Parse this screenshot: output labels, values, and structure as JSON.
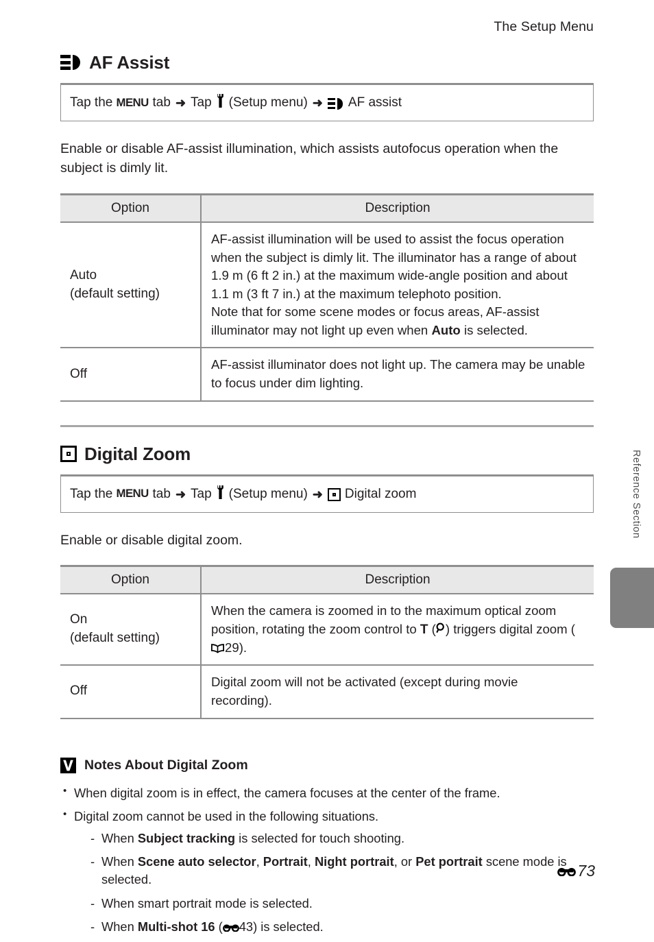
{
  "page": {
    "running_head": "The Setup Menu",
    "side_tab_label": "Reference Section",
    "footer_page": "73",
    "accent_gray": "#808080",
    "rule_gray": "#8e8e8e",
    "header_fill": "#e8e8e8"
  },
  "sections": [
    {
      "id": "af-assist",
      "icon": "af-assist-icon",
      "title": "AF Assist",
      "path": {
        "prefix": "Tap the",
        "menu_word": "MENU",
        "tab_word": "tab",
        "arrow": "➜",
        "tap_word": "Tap",
        "setup_icon": "wrench-icon",
        "setup_label": "(Setup menu)",
        "target_icon": "af-assist-icon",
        "target_label": "AF assist"
      },
      "intro": "Enable or disable AF-assist illumination, which assists autofocus operation when the subject is dimly lit.",
      "table": {
        "headers": [
          "Option",
          "Description"
        ],
        "rows": [
          {
            "option": "Auto",
            "option_note": "(default setting)",
            "description_lines": [
              "AF-assist illumination will be used to assist the focus operation",
              "when the subject is dimly lit. The illuminator has a range of about",
              "1.9 m (6 ft 2 in.) at the maximum wide-angle position and about",
              "1.1 m (3 ft 7 in.) at the maximum telephoto position.",
              "Note that for some scene modes or focus areas, AF-assist"
            ],
            "description_last_pre": "illuminator may not light up even when ",
            "description_last_bold": "Auto",
            "description_last_post": " is selected."
          },
          {
            "option": "Off",
            "option_note": "",
            "description_lines": [
              "AF-assist illuminator does not light up. The camera may be unable",
              "to focus under dim lighting."
            ]
          }
        ]
      }
    },
    {
      "id": "digital-zoom",
      "icon": "digital-zoom-icon",
      "title": "Digital Zoom",
      "path": {
        "prefix": "Tap the",
        "menu_word": "MENU",
        "tab_word": "tab",
        "arrow": "➜",
        "tap_word": "Tap",
        "setup_icon": "wrench-icon",
        "setup_label": "(Setup menu)",
        "target_icon": "digital-zoom-icon",
        "target_label": "Digital zoom"
      },
      "intro": "Enable or disable digital zoom.",
      "table": {
        "headers": [
          "Option",
          "Description"
        ],
        "rows": [
          {
            "option": "On",
            "option_note": "(default setting)",
            "desc_part1": "When the camera is zoomed in to the maximum optical zoom position, rotating the zoom control to ",
            "desc_tele": "T",
            "desc_mag_open": " (",
            "desc_mag": "Q",
            "desc_mag_close": ") ",
            "desc_part2": "triggers digital zoom (",
            "desc_ref_icon": "book-icon",
            "desc_ref_page": "29",
            "desc_part3": ")."
          },
          {
            "option": "Off",
            "option_note": "",
            "description_lines": [
              "Digital zoom will not be activated (except during movie",
              "recording)."
            ]
          }
        ]
      }
    }
  ],
  "notes": {
    "icon": "caution-icon",
    "title": "Notes About Digital Zoom",
    "bullets": [
      {
        "text": "When digital zoom is in effect, the camera focuses at the center of the frame."
      },
      {
        "text": "Digital zoom cannot be used in the following situations."
      }
    ],
    "subbullets": [
      {
        "pre": "When ",
        "bold": "Subject tracking",
        "post": " is selected for touch shooting."
      },
      {
        "pre": "When ",
        "bold": "Scene auto selector",
        "mid1": ", ",
        "bold2": "Portrait",
        "mid2": ", ",
        "bold3": "Night portrait",
        "mid3": ", or ",
        "bold4": "Pet portrait",
        "post": " scene mode is selected."
      },
      {
        "pre": "When smart portrait mode is selected.",
        "bold": "",
        "post": ""
      },
      {
        "pre": "When ",
        "bold": "Multi-shot 16",
        "mid1": " (",
        "ref_icon": "e-reference-icon",
        "ref_page": "43",
        "post": ") is selected."
      }
    ]
  }
}
